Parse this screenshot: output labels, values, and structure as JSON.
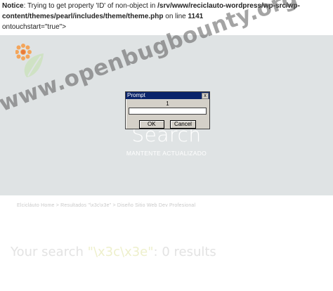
{
  "notice": {
    "label": "Notice",
    "text1": ": Trying to get property 'ID' of non-object in ",
    "path": "/srv/www/recicla­uto-wordpress/wp-src/wp-content/themes/pearl/includes/theme/theme.php",
    "text2": " on line ",
    "line": "1141",
    "text3": "ontouchstart=\"true\">"
  },
  "hero": {
    "title": "Search",
    "subtitle": "MANTENTE ACTUALIZADO"
  },
  "breadcrumb": "Elcicláuto Home > Resultados \"\\x3c\\x3e\" > Diseño Sitio Web Dev Profesional",
  "results": {
    "prefix": "Your search ",
    "query": "\"\\x3c\\x3e\"",
    "suffix": ": 0 results"
  },
  "watermark": "www.openbugbounty.org",
  "dialog": {
    "title": "Prompt",
    "close": "x",
    "message": "1",
    "input_value": "",
    "ok": "OK",
    "cancel": "Cancel"
  },
  "colors": {
    "hero_bg": "#dfe3e4",
    "titlebar": "#0a246a",
    "logo_orange": "#f4a55a",
    "logo_green": "#cfe2c4"
  },
  "icons": [
    "leaf-logo-icon",
    "close-icon"
  ]
}
